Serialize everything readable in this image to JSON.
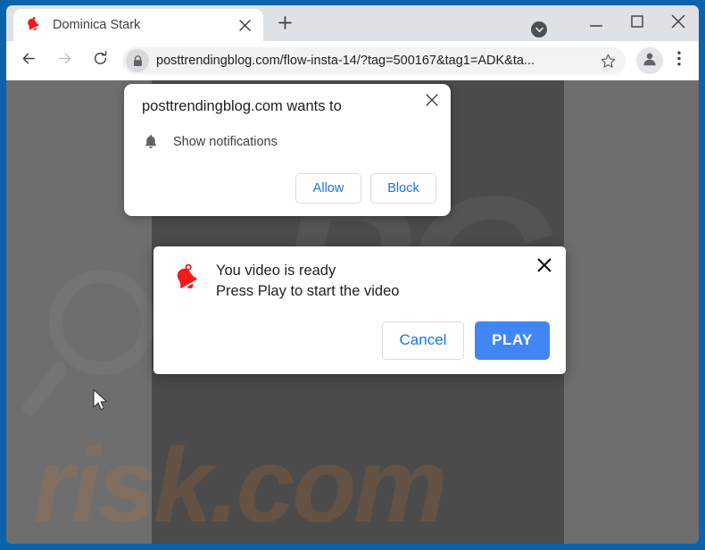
{
  "browser": {
    "tab": {
      "title": "Dominica Stark",
      "favicon_icon": "red-bell-icon",
      "close_icon": "close-icon"
    },
    "new_tab_icon": "plus-icon",
    "window_controls": {
      "dropdown_icon": "chevron-down-circle-icon",
      "minimize_icon": "minimize-icon",
      "maximize_icon": "maximize-icon",
      "close_icon": "close-icon"
    },
    "toolbar": {
      "back_icon": "arrow-left-icon",
      "forward_icon": "arrow-right-icon",
      "reload_icon": "reload-icon",
      "lock_icon": "lock-icon",
      "url_domain": "posttrendingblog.com",
      "url_path": "/flow-insta-14/?tag=500167&tag1=ADK&ta...",
      "url_full": "posttrendingblog.com/flow-insta-14/?tag=500167&tag1=ADK&ta...",
      "bookmark_icon": "star-icon",
      "profile_icon": "avatar-icon",
      "menu_icon": "three-dot-menu-icon"
    }
  },
  "permission_dialog": {
    "title": "posttrendingblog.com wants to",
    "close_icon": "close-icon",
    "permission_icon": "bell-icon",
    "permission_label": "Show notifications",
    "allow_label": "Allow",
    "block_label": "Block"
  },
  "page_modal": {
    "icon": "red-bell-icon",
    "close_icon": "close-icon",
    "line1": "You video is ready",
    "line2": "Press Play to start the video",
    "cancel_label": "Cancel",
    "play_label": "PLAY"
  },
  "page_background": {
    "watermark_text": "risk.com",
    "watermark_logo": "pc-logo-watermark",
    "magnifier_icon": "magnifier-watermark-icon"
  },
  "colors": {
    "window_frame": "#0a64ad",
    "tabstrip": "#dee1e6",
    "accent_blue": "#1a73e8",
    "play_button": "#4285f4",
    "bell_red": "#ee1c1c",
    "page_dark": "#4b4b4b",
    "page_gray": "#6e6e6e",
    "watermark_orange": "#d67828"
  },
  "cursor": {
    "icon": "mouse-pointer-icon"
  }
}
